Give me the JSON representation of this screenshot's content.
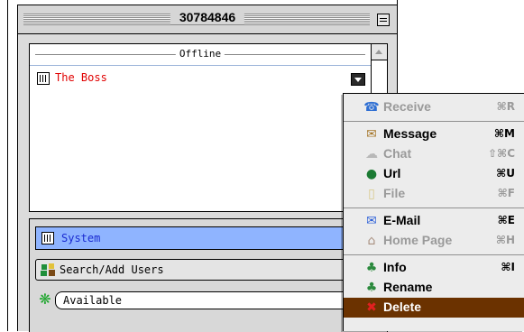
{
  "window": {
    "title": "30784846"
  },
  "contact_list": {
    "group_label": "Offline",
    "contacts": [
      {
        "name": "The Boss",
        "name_color": "#e00000"
      }
    ]
  },
  "lower_panel": {
    "system_label": "System",
    "search_button_label": "Search/Add Users",
    "status_value": "Available"
  },
  "context_menu": {
    "items": [
      {
        "label": "Receive",
        "shortcut": "⌘R",
        "icon": "receive-icon",
        "enabled": false
      },
      {
        "label": "Message",
        "shortcut": "⌘M",
        "icon": "message-icon",
        "enabled": true
      },
      {
        "label": "Chat",
        "shortcut": "⇧⌘C",
        "icon": "chat-icon",
        "enabled": false
      },
      {
        "label": "Url",
        "shortcut": "⌘U",
        "icon": "url-globe-icon",
        "enabled": true
      },
      {
        "label": "File",
        "shortcut": "⌘F",
        "icon": "file-icon",
        "enabled": false
      },
      {
        "label": "E-Mail",
        "shortcut": "⌘E",
        "icon": "email-icon",
        "enabled": true
      },
      {
        "label": "Home Page",
        "shortcut": "⌘H",
        "icon": "home-page-icon",
        "enabled": false
      },
      {
        "label": "Info",
        "shortcut": "⌘I",
        "icon": "info-icon",
        "enabled": true
      },
      {
        "label": "Rename",
        "shortcut": "",
        "icon": "rename-icon",
        "enabled": true
      },
      {
        "label": "Delete",
        "shortcut": "",
        "icon": "delete-icon",
        "enabled": true,
        "highlighted": true
      }
    ]
  },
  "colors": {
    "selection_blue": "#8fb4ff",
    "menu_highlight": "#6b3200",
    "contact_offline_red": "#e00000",
    "system_label_blue": "#1a2bd1"
  }
}
